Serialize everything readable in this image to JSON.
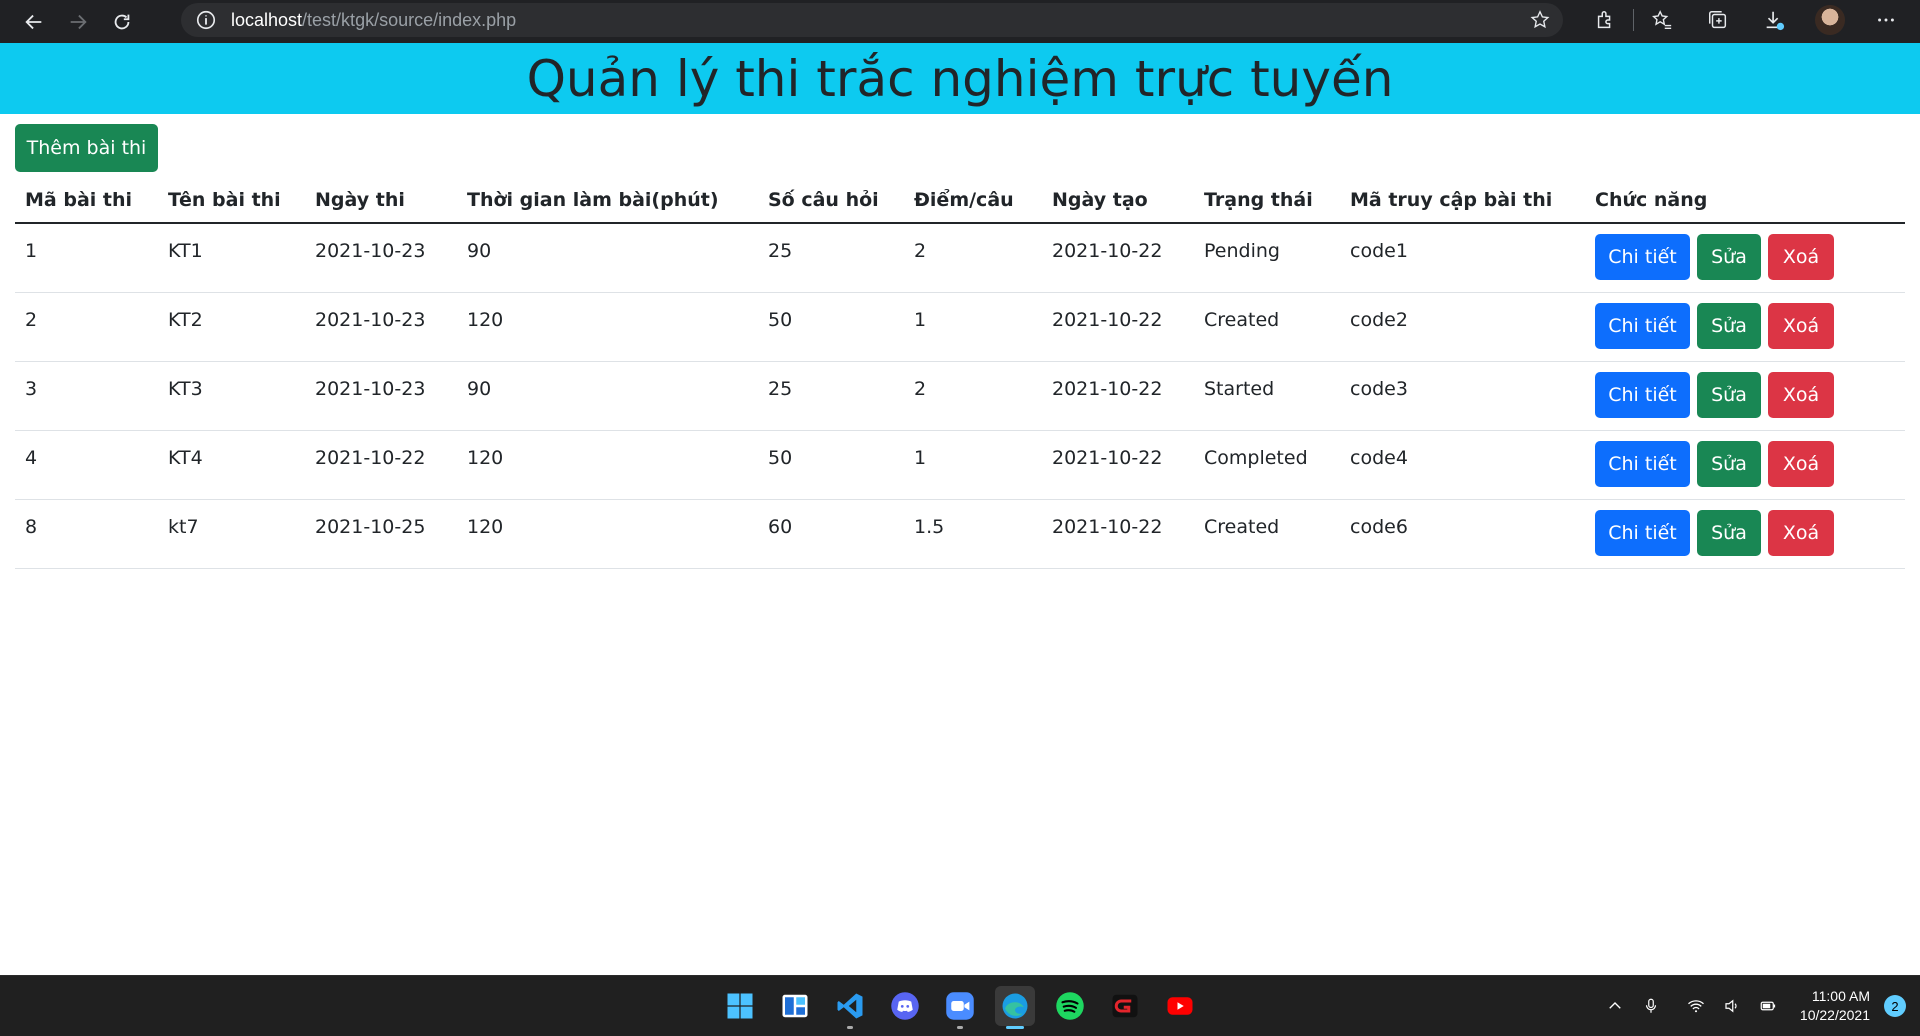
{
  "browser": {
    "url_host": "localhost",
    "url_path": "/test/ktgk/source/index.php"
  },
  "header": {
    "title": "Quản lý thi trắc nghiệm trực tuyến"
  },
  "toolbar": {
    "add_label": "Thêm bài thi"
  },
  "table": {
    "headers": [
      "Mã bài thi",
      "Tên bài thi",
      "Ngày thi",
      "Thời gian làm bài(phút)",
      "Số câu hỏi",
      "Điểm/câu",
      "Ngày tạo",
      "Trạng thái",
      "Mã truy cập bài thi",
      "Chức năng"
    ],
    "rows": [
      [
        "1",
        "KT1",
        "2021-10-23",
        "90",
        "25",
        "2",
        "2021-10-22",
        "Pending",
        "code1"
      ],
      [
        "2",
        "KT2",
        "2021-10-23",
        "120",
        "50",
        "1",
        "2021-10-22",
        "Created",
        "code2"
      ],
      [
        "3",
        "KT3",
        "2021-10-23",
        "90",
        "25",
        "2",
        "2021-10-22",
        "Started",
        "code3"
      ],
      [
        "4",
        "KT4",
        "2021-10-22",
        "120",
        "50",
        "1",
        "2021-10-22",
        "Completed",
        "code4"
      ],
      [
        "8",
        "kt7",
        "2021-10-25",
        "120",
        "60",
        "1.5",
        "2021-10-22",
        "Created",
        "code6"
      ]
    ],
    "actions": {
      "detail": "Chi tiết",
      "edit": "Sửa",
      "delete": "Xoá"
    }
  },
  "taskbar": {
    "apps": [
      "windows-start-icon",
      "widgets-icon",
      "vscode-icon",
      "discord-icon",
      "zoom-icon",
      "edge-icon",
      "spotify-icon",
      "garena-icon",
      "youtube-icon"
    ],
    "time": "11:00 AM",
    "date": "10/22/2021",
    "notifications": "2"
  },
  "colors": {
    "header_bg": "#0dcaf0",
    "primary": "#0d6efd",
    "success": "#198754",
    "danger": "#dc3545"
  }
}
